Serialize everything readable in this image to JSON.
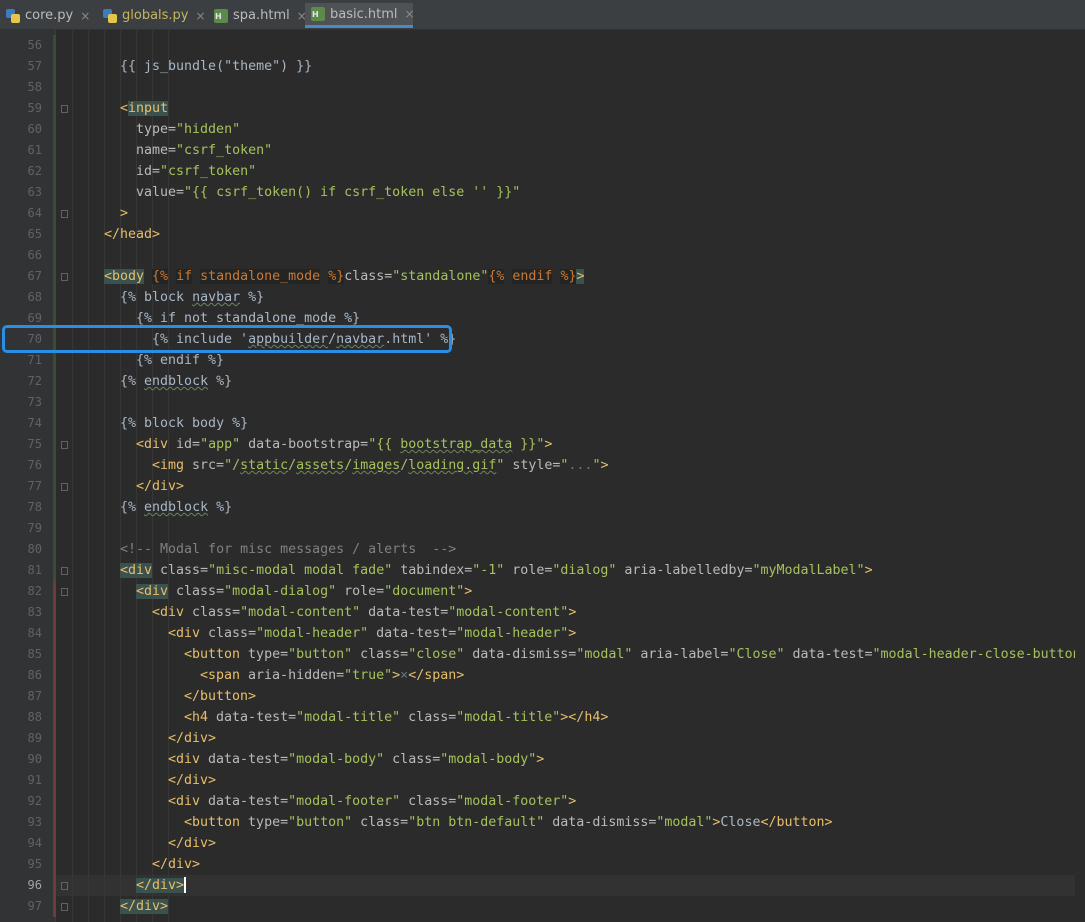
{
  "tabs": [
    {
      "label": "core.py",
      "icon": "python-file-icon",
      "kind": "py",
      "active": false
    },
    {
      "label": "globals.py",
      "icon": "python-file-icon",
      "kind": "py",
      "active": false,
      "modified": true
    },
    {
      "label": "spa.html",
      "icon": "html-file-icon",
      "kind": "htm",
      "active": false
    },
    {
      "label": "basic.html",
      "icon": "html-file-icon",
      "kind": "htm",
      "active": true
    }
  ],
  "close_glyph": "×",
  "current_line": 96,
  "highlighted_line": 70,
  "lines": [
    {
      "n": 56,
      "indent": 0,
      "t": [
        [
          "p",
          ""
        ]
      ]
    },
    {
      "n": 57,
      "indent": 3,
      "t": [
        [
          "p",
          "{{ js_bundle(\"theme\") }}"
        ]
      ]
    },
    {
      "n": 58,
      "indent": 0,
      "t": [
        [
          "p",
          ""
        ]
      ]
    },
    {
      "n": 59,
      "indent": 3,
      "t": [
        [
          "t",
          "<"
        ],
        [
          "thl",
          "input"
        ]
      ]
    },
    {
      "n": 60,
      "indent": 4,
      "t": [
        [
          "a",
          "type="
        ],
        [
          "s",
          "\"hidden\""
        ]
      ]
    },
    {
      "n": 61,
      "indent": 4,
      "t": [
        [
          "a",
          "name="
        ],
        [
          "s",
          "\"csrf_token\""
        ]
      ]
    },
    {
      "n": 62,
      "indent": 4,
      "t": [
        [
          "a",
          "id="
        ],
        [
          "s",
          "\"csrf_token\""
        ]
      ]
    },
    {
      "n": 63,
      "indent": 4,
      "t": [
        [
          "a",
          "value="
        ],
        [
          "s",
          "\"{{ csrf_token() if csrf_token else '' }}\""
        ]
      ]
    },
    {
      "n": 64,
      "indent": 3,
      "t": [
        [
          "t",
          ">"
        ]
      ]
    },
    {
      "n": 65,
      "indent": 2,
      "t": [
        [
          "t",
          "</head>"
        ]
      ]
    },
    {
      "n": 66,
      "indent": 0,
      "t": [
        [
          "p",
          ""
        ]
      ]
    },
    {
      "n": 67,
      "indent": 2,
      "t": [
        [
          "thl",
          "<body"
        ],
        [
          "p",
          " "
        ],
        [
          "j",
          "{%"
        ],
        [
          "p",
          " "
        ],
        [
          "j",
          "if"
        ],
        [
          "p",
          " "
        ],
        [
          "j",
          "standalone_mode"
        ],
        [
          "p",
          " "
        ],
        [
          "j",
          "%}"
        ],
        [
          "a",
          "class="
        ],
        [
          "s",
          "\"standalone\""
        ],
        [
          "j",
          "{%"
        ],
        [
          "p",
          " "
        ],
        [
          "j",
          "endif"
        ],
        [
          "p",
          " "
        ],
        [
          "j",
          "%}"
        ],
        [
          "thl",
          ">"
        ]
      ]
    },
    {
      "n": 68,
      "indent": 3,
      "t": [
        [
          "p",
          "{% block "
        ],
        [
          "sq",
          "navbar"
        ],
        [
          "p",
          " %}"
        ]
      ]
    },
    {
      "n": 69,
      "indent": 4,
      "t": [
        [
          "p",
          "{% if not standalone_mode %}"
        ]
      ]
    },
    {
      "n": 70,
      "indent": 5,
      "t": [
        [
          "p",
          "{% include '"
        ],
        [
          "sq",
          "appbuilder"
        ],
        [
          "p",
          "/"
        ],
        [
          "sq",
          "navbar"
        ],
        [
          "p",
          ".html' %}"
        ]
      ]
    },
    {
      "n": 71,
      "indent": 4,
      "t": [
        [
          "p",
          "{% endif %}"
        ]
      ]
    },
    {
      "n": 72,
      "indent": 3,
      "t": [
        [
          "p",
          "{% "
        ],
        [
          "sq",
          "endblock"
        ],
        [
          "p",
          " %}"
        ]
      ]
    },
    {
      "n": 73,
      "indent": 0,
      "t": [
        [
          "p",
          ""
        ]
      ]
    },
    {
      "n": 74,
      "indent": 3,
      "t": [
        [
          "p",
          "{% block body %}"
        ]
      ]
    },
    {
      "n": 75,
      "indent": 4,
      "t": [
        [
          "t",
          "<div "
        ],
        [
          "a",
          "id="
        ],
        [
          "s",
          "\"app\""
        ],
        [
          "a",
          " data-bootstrap="
        ],
        [
          "s",
          "\"{{ "
        ],
        [
          "ssq",
          "bootstrap_data"
        ],
        [
          "s",
          " }}\""
        ],
        [
          "t",
          ">"
        ]
      ]
    },
    {
      "n": 76,
      "indent": 5,
      "t": [
        [
          "t",
          "<img "
        ],
        [
          "a",
          "src="
        ],
        [
          "s",
          "\"/"
        ],
        [
          "ssq",
          "static"
        ],
        [
          "s",
          "/"
        ],
        [
          "ssq",
          "assets"
        ],
        [
          "s",
          "/"
        ],
        [
          "ssq",
          "images"
        ],
        [
          "s",
          "/"
        ],
        [
          "ssq",
          "loading.gif"
        ],
        [
          "s",
          "\""
        ],
        [
          "a",
          " style="
        ],
        [
          "s",
          "\""
        ],
        [
          "dim",
          "..."
        ],
        [
          "s",
          "\""
        ],
        [
          "t",
          ">"
        ]
      ]
    },
    {
      "n": 77,
      "indent": 4,
      "t": [
        [
          "t",
          "</div>"
        ]
      ]
    },
    {
      "n": 78,
      "indent": 3,
      "t": [
        [
          "p",
          "{% "
        ],
        [
          "sq",
          "endblock"
        ],
        [
          "p",
          " %}"
        ]
      ]
    },
    {
      "n": 79,
      "indent": 0,
      "t": [
        [
          "p",
          ""
        ]
      ]
    },
    {
      "n": 80,
      "indent": 3,
      "t": [
        [
          "c",
          "<!-- Modal for misc messages / alerts  -->"
        ]
      ]
    },
    {
      "n": 81,
      "indent": 3,
      "t": [
        [
          "thl",
          "<div"
        ],
        [
          "a",
          " class="
        ],
        [
          "s",
          "\"misc-modal modal fade\""
        ],
        [
          "a",
          " tabindex="
        ],
        [
          "s",
          "\"-1\""
        ],
        [
          "a",
          " role="
        ],
        [
          "s",
          "\"dialog\""
        ],
        [
          "a",
          " aria-labelledby="
        ],
        [
          "s",
          "\"myModalLabel\""
        ],
        [
          "t",
          ">"
        ]
      ]
    },
    {
      "n": 82,
      "indent": 4,
      "t": [
        [
          "thl",
          "<div"
        ],
        [
          "a",
          " class="
        ],
        [
          "s",
          "\"modal-dialog\""
        ],
        [
          "a",
          " role="
        ],
        [
          "s",
          "\"document\""
        ],
        [
          "t",
          ">"
        ]
      ]
    },
    {
      "n": 83,
      "indent": 5,
      "t": [
        [
          "t",
          "<div"
        ],
        [
          "a",
          " class="
        ],
        [
          "s",
          "\"modal-content\""
        ],
        [
          "a",
          " data-test="
        ],
        [
          "s",
          "\"modal-content\""
        ],
        [
          "t",
          ">"
        ]
      ]
    },
    {
      "n": 84,
      "indent": 6,
      "t": [
        [
          "t",
          "<div"
        ],
        [
          "a",
          " class="
        ],
        [
          "s",
          "\"modal-header\""
        ],
        [
          "a",
          " data-test="
        ],
        [
          "s",
          "\"modal-header\""
        ],
        [
          "t",
          ">"
        ]
      ]
    },
    {
      "n": 85,
      "indent": 7,
      "t": [
        [
          "t",
          "<button"
        ],
        [
          "a",
          " type="
        ],
        [
          "s",
          "\"button\""
        ],
        [
          "a",
          " class="
        ],
        [
          "s",
          "\"close\""
        ],
        [
          "a",
          " data-dismiss="
        ],
        [
          "s",
          "\"modal\""
        ],
        [
          "a",
          " aria-label="
        ],
        [
          "s",
          "\"Close\""
        ],
        [
          "a",
          " data-test="
        ],
        [
          "s",
          "\"modal-header-close-button\""
        ],
        [
          "t",
          ">"
        ]
      ]
    },
    {
      "n": 86,
      "indent": 8,
      "t": [
        [
          "t",
          "<span"
        ],
        [
          "a",
          " aria-hidden="
        ],
        [
          "s",
          "\"true\""
        ],
        [
          "t",
          ">"
        ],
        [
          "dim",
          "×"
        ],
        [
          "t",
          "</span>"
        ]
      ]
    },
    {
      "n": 87,
      "indent": 7,
      "t": [
        [
          "t",
          "</button>"
        ]
      ]
    },
    {
      "n": 88,
      "indent": 7,
      "t": [
        [
          "t",
          "<h4"
        ],
        [
          "a",
          " data-test="
        ],
        [
          "s",
          "\"modal-title\""
        ],
        [
          "a",
          " class="
        ],
        [
          "s",
          "\"modal-title\""
        ],
        [
          "t",
          "></h4>"
        ]
      ]
    },
    {
      "n": 89,
      "indent": 6,
      "t": [
        [
          "t",
          "</div>"
        ]
      ]
    },
    {
      "n": 90,
      "indent": 6,
      "t": [
        [
          "t",
          "<div"
        ],
        [
          "a",
          " data-test="
        ],
        [
          "s",
          "\"modal-body\""
        ],
        [
          "a",
          " class="
        ],
        [
          "s",
          "\"modal-body\""
        ],
        [
          "t",
          ">"
        ]
      ]
    },
    {
      "n": 91,
      "indent": 6,
      "t": [
        [
          "t",
          "</div>"
        ]
      ]
    },
    {
      "n": 92,
      "indent": 6,
      "t": [
        [
          "t",
          "<div"
        ],
        [
          "a",
          " data-test="
        ],
        [
          "s",
          "\"modal-footer\""
        ],
        [
          "a",
          " class="
        ],
        [
          "s",
          "\"modal-footer\""
        ],
        [
          "t",
          ">"
        ]
      ]
    },
    {
      "n": 93,
      "indent": 7,
      "t": [
        [
          "t",
          "<button"
        ],
        [
          "a",
          " type="
        ],
        [
          "s",
          "\"button\""
        ],
        [
          "a",
          " class="
        ],
        [
          "s",
          "\"btn btn-default\""
        ],
        [
          "a",
          " data-dismiss="
        ],
        [
          "s",
          "\"modal\""
        ],
        [
          "t",
          ">"
        ],
        [
          "p",
          "Close"
        ],
        [
          "t",
          "</button>"
        ]
      ]
    },
    {
      "n": 94,
      "indent": 6,
      "t": [
        [
          "t",
          "</div>"
        ]
      ]
    },
    {
      "n": 95,
      "indent": 5,
      "t": [
        [
          "t",
          "</div>"
        ]
      ]
    },
    {
      "n": 96,
      "indent": 4,
      "t": [
        [
          "thl",
          "</div>"
        ],
        [
          "caret",
          ""
        ]
      ]
    },
    {
      "n": 97,
      "indent": 3,
      "t": [
        [
          "thl",
          "</div>"
        ]
      ]
    }
  ],
  "colors": {
    "background": "#2b2b2b",
    "gutter": "#313335",
    "tag": "#e8bf6a",
    "attribute": "#bababa",
    "string": "#a5c25c",
    "comment": "#808080",
    "highlight_box": "#2a8ee6"
  }
}
